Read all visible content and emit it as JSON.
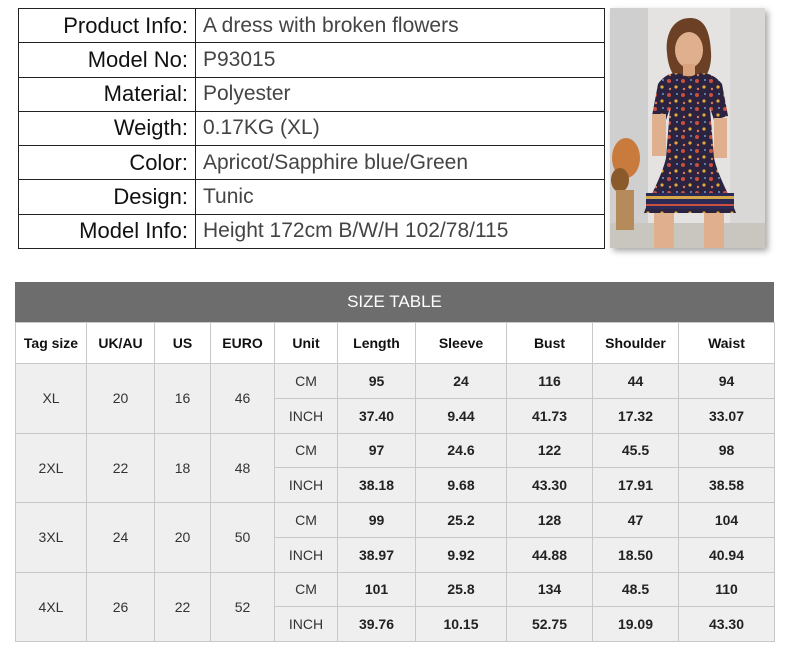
{
  "info": [
    {
      "label": "Product Info:",
      "value": "A dress with broken flowers"
    },
    {
      "label": "Model No:",
      "value": "P93015"
    },
    {
      "label": "Material:",
      "value": "Polyester"
    },
    {
      "label": "Weigth:",
      "value": "0.17KG (XL)"
    },
    {
      "label": "Color:",
      "value": "Apricot/Sapphire blue/Green"
    },
    {
      "label": "Design:",
      "value": "Tunic"
    },
    {
      "label": "Model Info:",
      "value": "Height 172cm  B/W/H 102/78/115"
    }
  ],
  "size_table": {
    "title": "SIZE TABLE",
    "headers": [
      "Tag size",
      "UK/AU",
      "US",
      "EURO",
      "Unit",
      "Length",
      "Sleeve",
      "Bust",
      "Shoulder",
      "Waist"
    ],
    "rows": [
      {
        "tag": "XL",
        "uk": "20",
        "us": "16",
        "euro": "46",
        "cm": {
          "unit": "CM",
          "length": "95",
          "sleeve": "24",
          "bust": "116",
          "shoulder": "44",
          "waist": "94"
        },
        "inch": {
          "unit": "INCH",
          "length": "37.40",
          "sleeve": "9.44",
          "bust": "41.73",
          "shoulder": "17.32",
          "waist": "33.07"
        }
      },
      {
        "tag": "2XL",
        "uk": "22",
        "us": "18",
        "euro": "48",
        "cm": {
          "unit": "CM",
          "length": "97",
          "sleeve": "24.6",
          "bust": "122",
          "shoulder": "45.5",
          "waist": "98"
        },
        "inch": {
          "unit": "INCH",
          "length": "38.18",
          "sleeve": "9.68",
          "bust": "43.30",
          "shoulder": "17.91",
          "waist": "38.58"
        }
      },
      {
        "tag": "3XL",
        "uk": "24",
        "us": "20",
        "euro": "50",
        "cm": {
          "unit": "CM",
          "length": "99",
          "sleeve": "25.2",
          "bust": "128",
          "shoulder": "47",
          "waist": "104"
        },
        "inch": {
          "unit": "INCH",
          "length": "38.97",
          "sleeve": "9.92",
          "bust": "44.88",
          "shoulder": "18.50",
          "waist": "40.94"
        }
      },
      {
        "tag": "4XL",
        "uk": "26",
        "us": "22",
        "euro": "52",
        "cm": {
          "unit": "CM",
          "length": "101",
          "sleeve": "25.8",
          "bust": "134",
          "shoulder": "48.5",
          "waist": "110"
        },
        "inch": {
          "unit": "INCH",
          "length": "39.76",
          "sleeve": "10.15",
          "bust": "52.75",
          "shoulder": "19.09",
          "waist": "43.30"
        }
      }
    ]
  },
  "colors": {
    "title_bar": "#6d6d6d",
    "cell_bg": "#efefef",
    "border": "#c8c8c8"
  }
}
